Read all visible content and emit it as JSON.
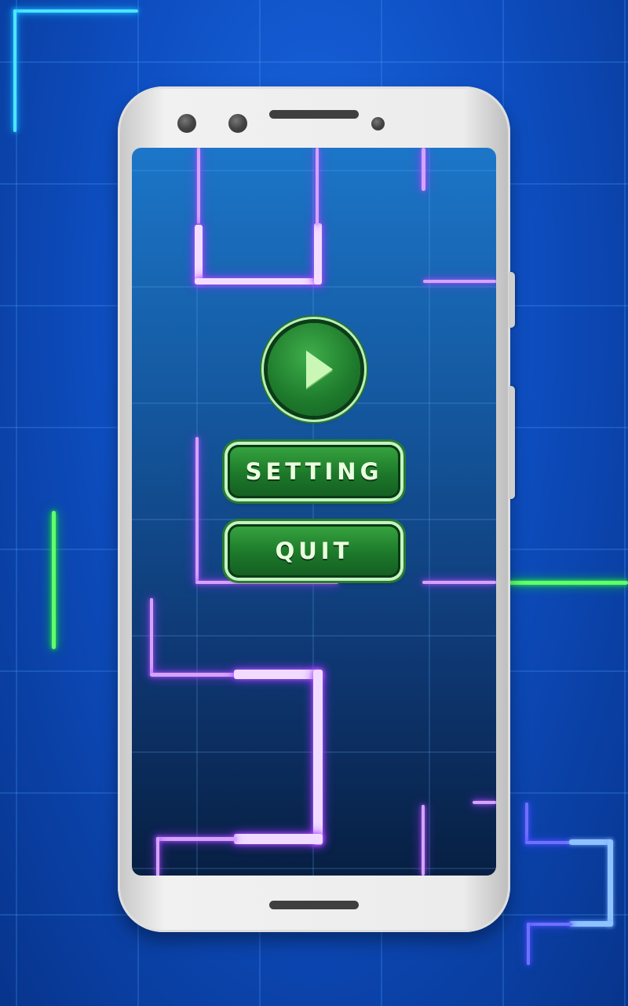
{
  "game": {
    "buttons": {
      "play_icon": "play-icon",
      "setting_label": "SETTING",
      "quit_label": "QUIT"
    },
    "colors": {
      "background": "#0e4fc3",
      "screen": "#14579e",
      "button_green": "#1e7b2c",
      "neon_violet": "#b45aff",
      "neon_cyan": "#21c8ff",
      "neon_green": "#29ff3d"
    }
  }
}
